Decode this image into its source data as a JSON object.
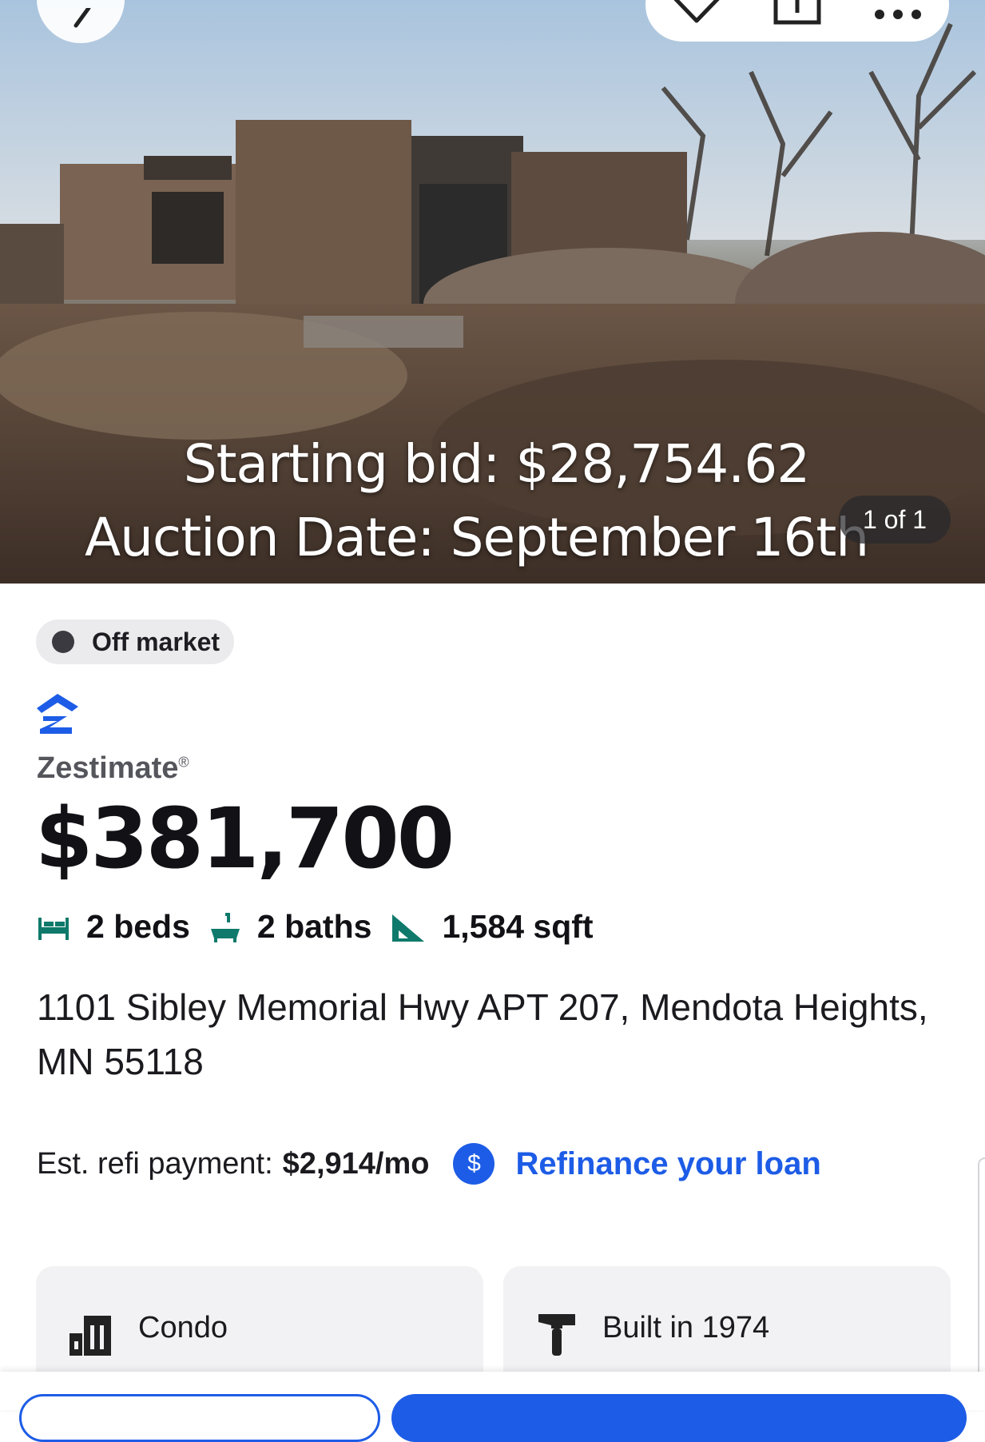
{
  "hero": {
    "overlay_bid": "Starting bid: $28,754.62",
    "overlay_date": "Auction Date: September 16th",
    "photo_count": "1 of 1"
  },
  "listing": {
    "status": "Off market",
    "zestimate_label": "Zestimate",
    "zestimate_mark": "®",
    "zestimate_value": "$381,700",
    "beds": "2 beds",
    "baths": "2 baths",
    "sqft": "1,584 sqft",
    "address": "1101 Sibley Memorial Hwy APT 207, Mendota Heights, MN 55118"
  },
  "refi": {
    "label": "Est. refi payment:",
    "amount": "$2,914/mo",
    "icon_glyph": "$",
    "link": "Refinance your loan"
  },
  "facts": {
    "type": "Condo",
    "built": "Built in 1974"
  },
  "icons": {
    "back": "chevron-left-icon",
    "save": "heart-icon",
    "share": "share-icon",
    "more": "more-icon",
    "brand": "zillow-logo-icon",
    "beds": "bed-icon",
    "baths": "bathtub-icon",
    "sqft": "ruler-triangle-icon",
    "refi": "dollar-circle-icon",
    "condo": "building-icon",
    "built": "hammer-icon"
  },
  "colors": {
    "accent": "#1d5ce6",
    "facts_icon": "#0f7a6b",
    "status_dot": "#3a3a40"
  }
}
